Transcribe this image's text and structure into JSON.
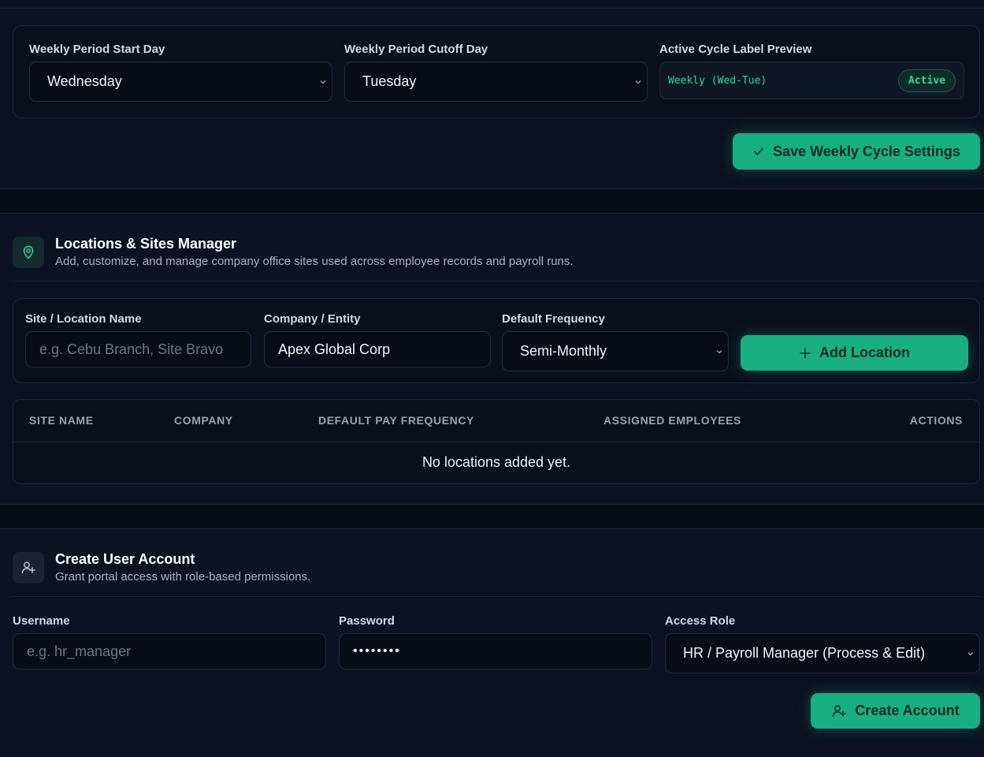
{
  "weekly_cycle": {
    "start_day": {
      "label": "Weekly Period Start Day",
      "value": "Wednesday"
    },
    "cutoff_day": {
      "label": "Weekly Period Cutoff Day",
      "value": "Tuesday"
    },
    "preview": {
      "label": "Active Cycle Label Preview",
      "value": "Weekly (Wed-Tue)",
      "badge": "Active"
    },
    "save_label": "Save Weekly Cycle Settings"
  },
  "locations": {
    "title": "Locations & Sites Manager",
    "subtitle": "Add, customize, and manage company office sites used across employee records and payroll runs.",
    "site_name": {
      "label": "Site / Location Name",
      "placeholder": "e.g. Cebu Branch, Site Bravo"
    },
    "company": {
      "label": "Company / Entity",
      "value": "Apex Global Corp"
    },
    "frequency": {
      "label": "Default Frequency",
      "value": "Semi-Monthly"
    },
    "add_label": "Add Location",
    "table": {
      "columns": [
        "SITE NAME",
        "COMPANY",
        "DEFAULT PAY FREQUENCY",
        "ASSIGNED EMPLOYEES",
        "ACTIONS"
      ],
      "empty_text": "No locations added yet."
    }
  },
  "users": {
    "title": "Create User Account",
    "subtitle": "Grant portal access with role-based permissions.",
    "username": {
      "label": "Username",
      "placeholder": "e.g. hr_manager"
    },
    "password": {
      "label": "Password",
      "value": "••••••••"
    },
    "role": {
      "label": "Access Role",
      "value": "HR / Payroll Manager (Process & Edit)"
    },
    "create_label": "Create Account"
  },
  "colors": {
    "accent": "#18b081",
    "background": "#0c1223",
    "badge_text": "#2fd89a"
  },
  "icons": [
    "chevron-down-icon",
    "check-icon",
    "map-pin-icon",
    "plus-icon",
    "user-plus-icon"
  ]
}
